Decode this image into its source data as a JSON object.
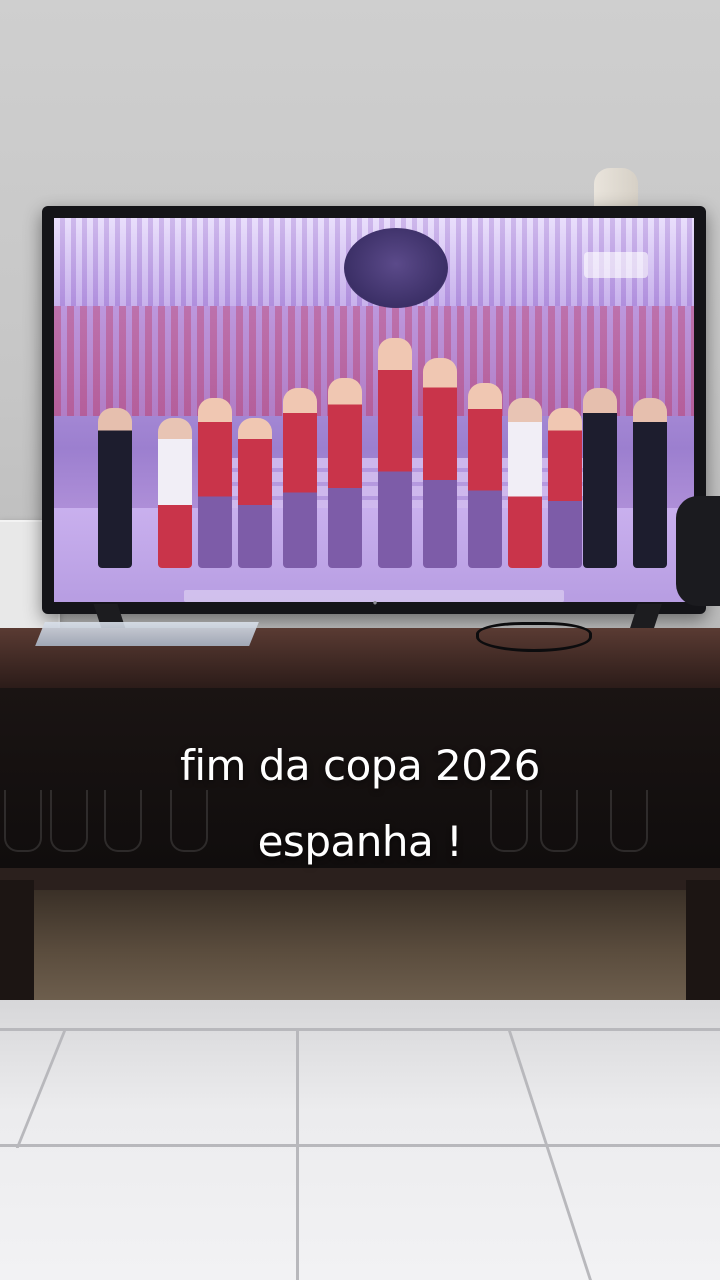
{
  "caption": {
    "line1": "fim da copa 2026",
    "line2": "espanha !"
  },
  "colors": {
    "caption_text": "#ffffff",
    "tv_screen_tint": "#b49be0",
    "rack_wood": "#3e2823",
    "floor_tile": "#ececee"
  }
}
